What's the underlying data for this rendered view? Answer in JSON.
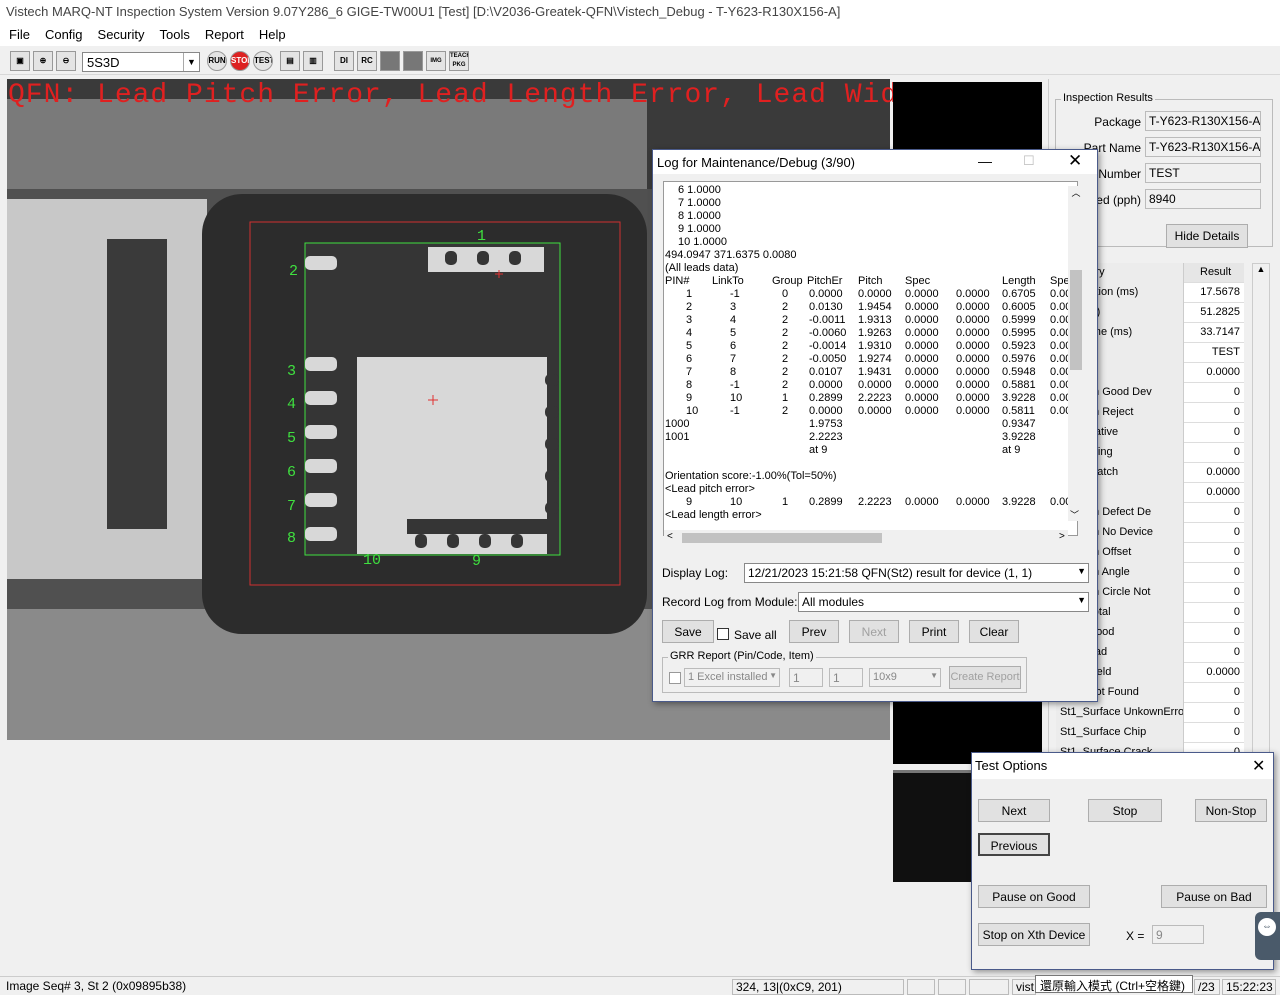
{
  "window": {
    "title": "Vistech MARQ-NT Inspection System Version 9.07Y286_6 GIGE-TW00U1 [Test] [D:\\V2036-Greatek-QFN\\Vistech_Debug - T-Y623-R130X156-A]"
  },
  "menu": [
    "File",
    "Config",
    "Security",
    "Tools",
    "Report",
    "Help"
  ],
  "toolbar": {
    "combo_value": "5S3D",
    "buttons": [
      "camera-icon",
      "zoom-in-icon",
      "zoom-out-icon",
      "run-icon",
      "stop-icon",
      "test-icon",
      "open-icon",
      "save-icon",
      "di-icon",
      "rc-icon",
      "square-icon",
      "square2-icon",
      "image-icon",
      "teach-pkg-icon"
    ],
    "labels": {
      "run": "RUN",
      "stop": "STOP",
      "test": "TEST",
      "di": "DI",
      "rc": "RC",
      "img": "IMG",
      "pkg": "TEACH PKG"
    }
  },
  "viewer": {
    "error_text": "QFN: Lead Pitch Error, Lead Length Error, Lead Width",
    "pins": [
      "1",
      "2",
      "3",
      "4",
      "5",
      "6",
      "7",
      "8",
      "9",
      "10"
    ]
  },
  "inspection_results": {
    "legend": "Inspection Results",
    "rows": [
      {
        "label": "Package",
        "value": "T-Y623-R130X156-A"
      },
      {
        "label": "Part Name",
        "value": "T-Y623-R130X156-A"
      },
      {
        "label": "it Number",
        "value": "TEST"
      },
      {
        "label": "eed (pph)",
        "value": "8940"
      }
    ],
    "hide_details": "Hide Details"
  },
  "results_grid": {
    "header": {
      "category": "Category",
      "result": "Result"
    },
    "rows": [
      {
        "c": "Acquisition (ms)",
        "r": "17.5678"
      },
      {
        "c": "me (ms)",
        "r": "51.2825"
      },
      {
        "c": "sing Time (ms)",
        "r": "33.7147"
      },
      {
        "c": "ber",
        "r": "TEST"
      },
      {
        "c": "eld",
        "r": "0.0000"
      },
      {
        "c": "entation Good Dev",
        "r": "0"
      },
      {
        "c": "entation Reject",
        "r": "0"
      },
      {
        "c": "ch Negative",
        "r": "0"
      },
      {
        "c": "ch Nothing",
        "r": "0"
      },
      {
        "c": "sitive Match",
        "r": "0.0000"
      },
      {
        "c": "Diff",
        "r": "0.0000"
      },
      {
        "c": "entation Defect De",
        "r": "0"
      },
      {
        "c": "entation No Device",
        "r": "0"
      },
      {
        "c": "entation Offset",
        "r": "0"
      },
      {
        "c": "entation Angle",
        "r": "0"
      },
      {
        "c": "entation Circle Not",
        "r": "0"
      },
      {
        "c": "rface Total",
        "r": "0"
      },
      {
        "c": "rface Good",
        "r": "0"
      },
      {
        "c": "rface Bad",
        "r": "0"
      },
      {
        "c": "rface Yield",
        "r": "0.0000"
      },
      {
        "c": "rface Not Found",
        "r": "0"
      },
      {
        "c": "St1_Surface UnkownErro",
        "r": "0"
      },
      {
        "c": "St1_Surface Chip",
        "r": "0"
      },
      {
        "c": "St1_Surface Crack",
        "r": "0"
      }
    ]
  },
  "log_window": {
    "title": "Log for Maintenance/Debug (3/90)",
    "lines": [
      "   6   1.0000",
      "   7   1.0000",
      "   8   1.0000",
      "   9   1.0000",
      "   10   1.0000",
      "494.0947 371.6375  0.0080",
      "(All leads data)"
    ],
    "headers": [
      "PIN#",
      "LinkTo",
      "Group",
      "PitchEr",
      "Pitch",
      "Spec",
      "",
      "Length",
      "Spec"
    ],
    "table": [
      [
        "1",
        "-1",
        "0",
        "0.0000",
        "0.0000",
        "0.0000",
        "0.0000",
        "0.6705",
        "0.00"
      ],
      [
        "2",
        "3",
        "2",
        "0.0130",
        "1.9454",
        "0.0000",
        "0.0000",
        "0.6005",
        "0.00"
      ],
      [
        "3",
        "4",
        "2",
        "-0.0011",
        "1.9313",
        "0.0000",
        "0.0000",
        "0.5999",
        "0.00"
      ],
      [
        "4",
        "5",
        "2",
        "-0.0060",
        "1.9263",
        "0.0000",
        "0.0000",
        "0.5995",
        "0.00"
      ],
      [
        "5",
        "6",
        "2",
        "-0.0014",
        "1.9310",
        "0.0000",
        "0.0000",
        "0.5923",
        "0.00"
      ],
      [
        "6",
        "7",
        "2",
        "-0.0050",
        "1.9274",
        "0.0000",
        "0.0000",
        "0.5976",
        "0.00"
      ],
      [
        "7",
        "8",
        "2",
        "0.0107",
        "1.9431",
        "0.0000",
        "0.0000",
        "0.5948",
        "0.00"
      ],
      [
        "8",
        "-1",
        "2",
        "0.0000",
        "0.0000",
        "0.0000",
        "0.0000",
        "0.5881",
        "0.00"
      ],
      [
        "9",
        "10",
        "1",
        "0.2899",
        "2.2223",
        "0.0000",
        "0.0000",
        "3.9228",
        "0.00"
      ],
      [
        "10",
        "-1",
        "2",
        "0.0000",
        "0.0000",
        "0.0000",
        "0.0000",
        "0.5811",
        "0.00"
      ]
    ],
    "summary": [
      {
        "left": "1000",
        "pitch": "1.9753",
        "length": "0.9347"
      },
      {
        "left": "1001",
        "pitch": "2.2223",
        "length": "3.9228"
      },
      {
        "left": "",
        "pitch": "at      9",
        "length": "at      9"
      }
    ],
    "orientation": "Orientation score:-1.00%(Tol=50%)",
    "pitch_error_tag": "<Lead pitch error>",
    "pitch_error_row": [
      "9",
      "10",
      "1",
      "0.2899",
      "2.2223",
      "0.0000",
      "0.0000",
      "3.9228",
      "0.00"
    ],
    "length_error_tag": "<Lead length error>",
    "display_log_label": "Display Log:",
    "display_log_value": "12/21/2023 15:21:58 QFN(St2) result for device (1, 1)",
    "record_log_label": "Record Log from Module:",
    "record_log_value": "All modules",
    "buttons": {
      "save": "Save",
      "save_all": "Save all",
      "prev": "Prev",
      "next": "Next",
      "print": "Print",
      "clear": "Clear"
    },
    "grr": {
      "legend": "GRR Report (Pin/Code, Item)",
      "excel": "1 Excel installed",
      "v1": "1",
      "v2": "1",
      "grid": "10x9",
      "create": "Create Report"
    }
  },
  "test_options": {
    "title": "Test Options",
    "next": "Next",
    "stop": "Stop",
    "non_stop": "Non-Stop",
    "previous": "Previous",
    "pause_good": "Pause on Good",
    "pause_bad": "Pause on Bad",
    "stop_xth": "Stop on Xth Device",
    "x_label": "X =",
    "x_value": "9"
  },
  "statusbar": {
    "seq": "Image Seq# 3, St 2 (0x09895b38)",
    "coords": "324, 13|(0xC9, 201)",
    "vist": "vist",
    "ime_tip": "還原輸入模式 (Ctrl+空格鍵)",
    "date": "/23",
    "time": "15:22:23"
  }
}
